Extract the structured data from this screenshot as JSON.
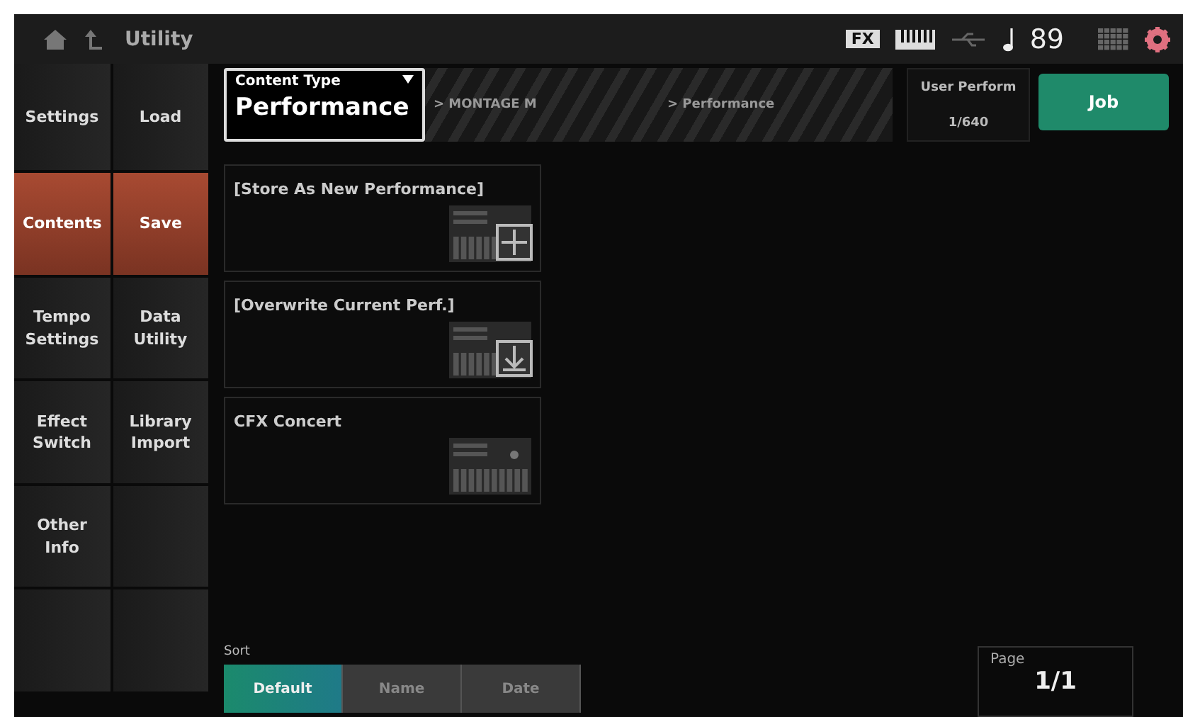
{
  "header": {
    "title": "Utility",
    "fx_badge": "FX",
    "tempo": "89"
  },
  "sidebar": {
    "categories": [
      {
        "label": "Settings",
        "selected": false
      },
      {
        "label": "Contents",
        "selected": true
      },
      {
        "label": "Tempo Settings",
        "selected": false
      },
      {
        "label": "Effect Switch",
        "selected": false
      },
      {
        "label": "Other Info",
        "selected": false
      },
      {
        "selected": false
      }
    ],
    "subitems": [
      {
        "label": "Load",
        "selected": false
      },
      {
        "label": "Save",
        "selected": true
      },
      {
        "label": "Data Utility",
        "selected": false
      },
      {
        "label": "Library Import",
        "selected": false
      },
      {
        "selected": false
      },
      {
        "selected": false
      }
    ]
  },
  "content_type": {
    "label": "Content Type",
    "value": "Performance"
  },
  "breadcrumb": [
    "> MONTAGE M",
    "> Performance"
  ],
  "user_perform": {
    "label": "User Perform",
    "value": "1/640"
  },
  "job_button": "Job",
  "entries": [
    {
      "title": "[Store As New Performance]",
      "kind": "new"
    },
    {
      "title": "[Overwrite Current Perf.]",
      "kind": "overwrite"
    },
    {
      "title": "CFX Concert",
      "kind": "plain"
    }
  ],
  "sort": {
    "label": "Sort",
    "options": [
      {
        "label": "Default",
        "selected": true
      },
      {
        "label": "Name",
        "selected": false
      },
      {
        "label": "Date",
        "selected": false
      }
    ]
  },
  "page": {
    "label": "Page",
    "value": "1/1"
  }
}
